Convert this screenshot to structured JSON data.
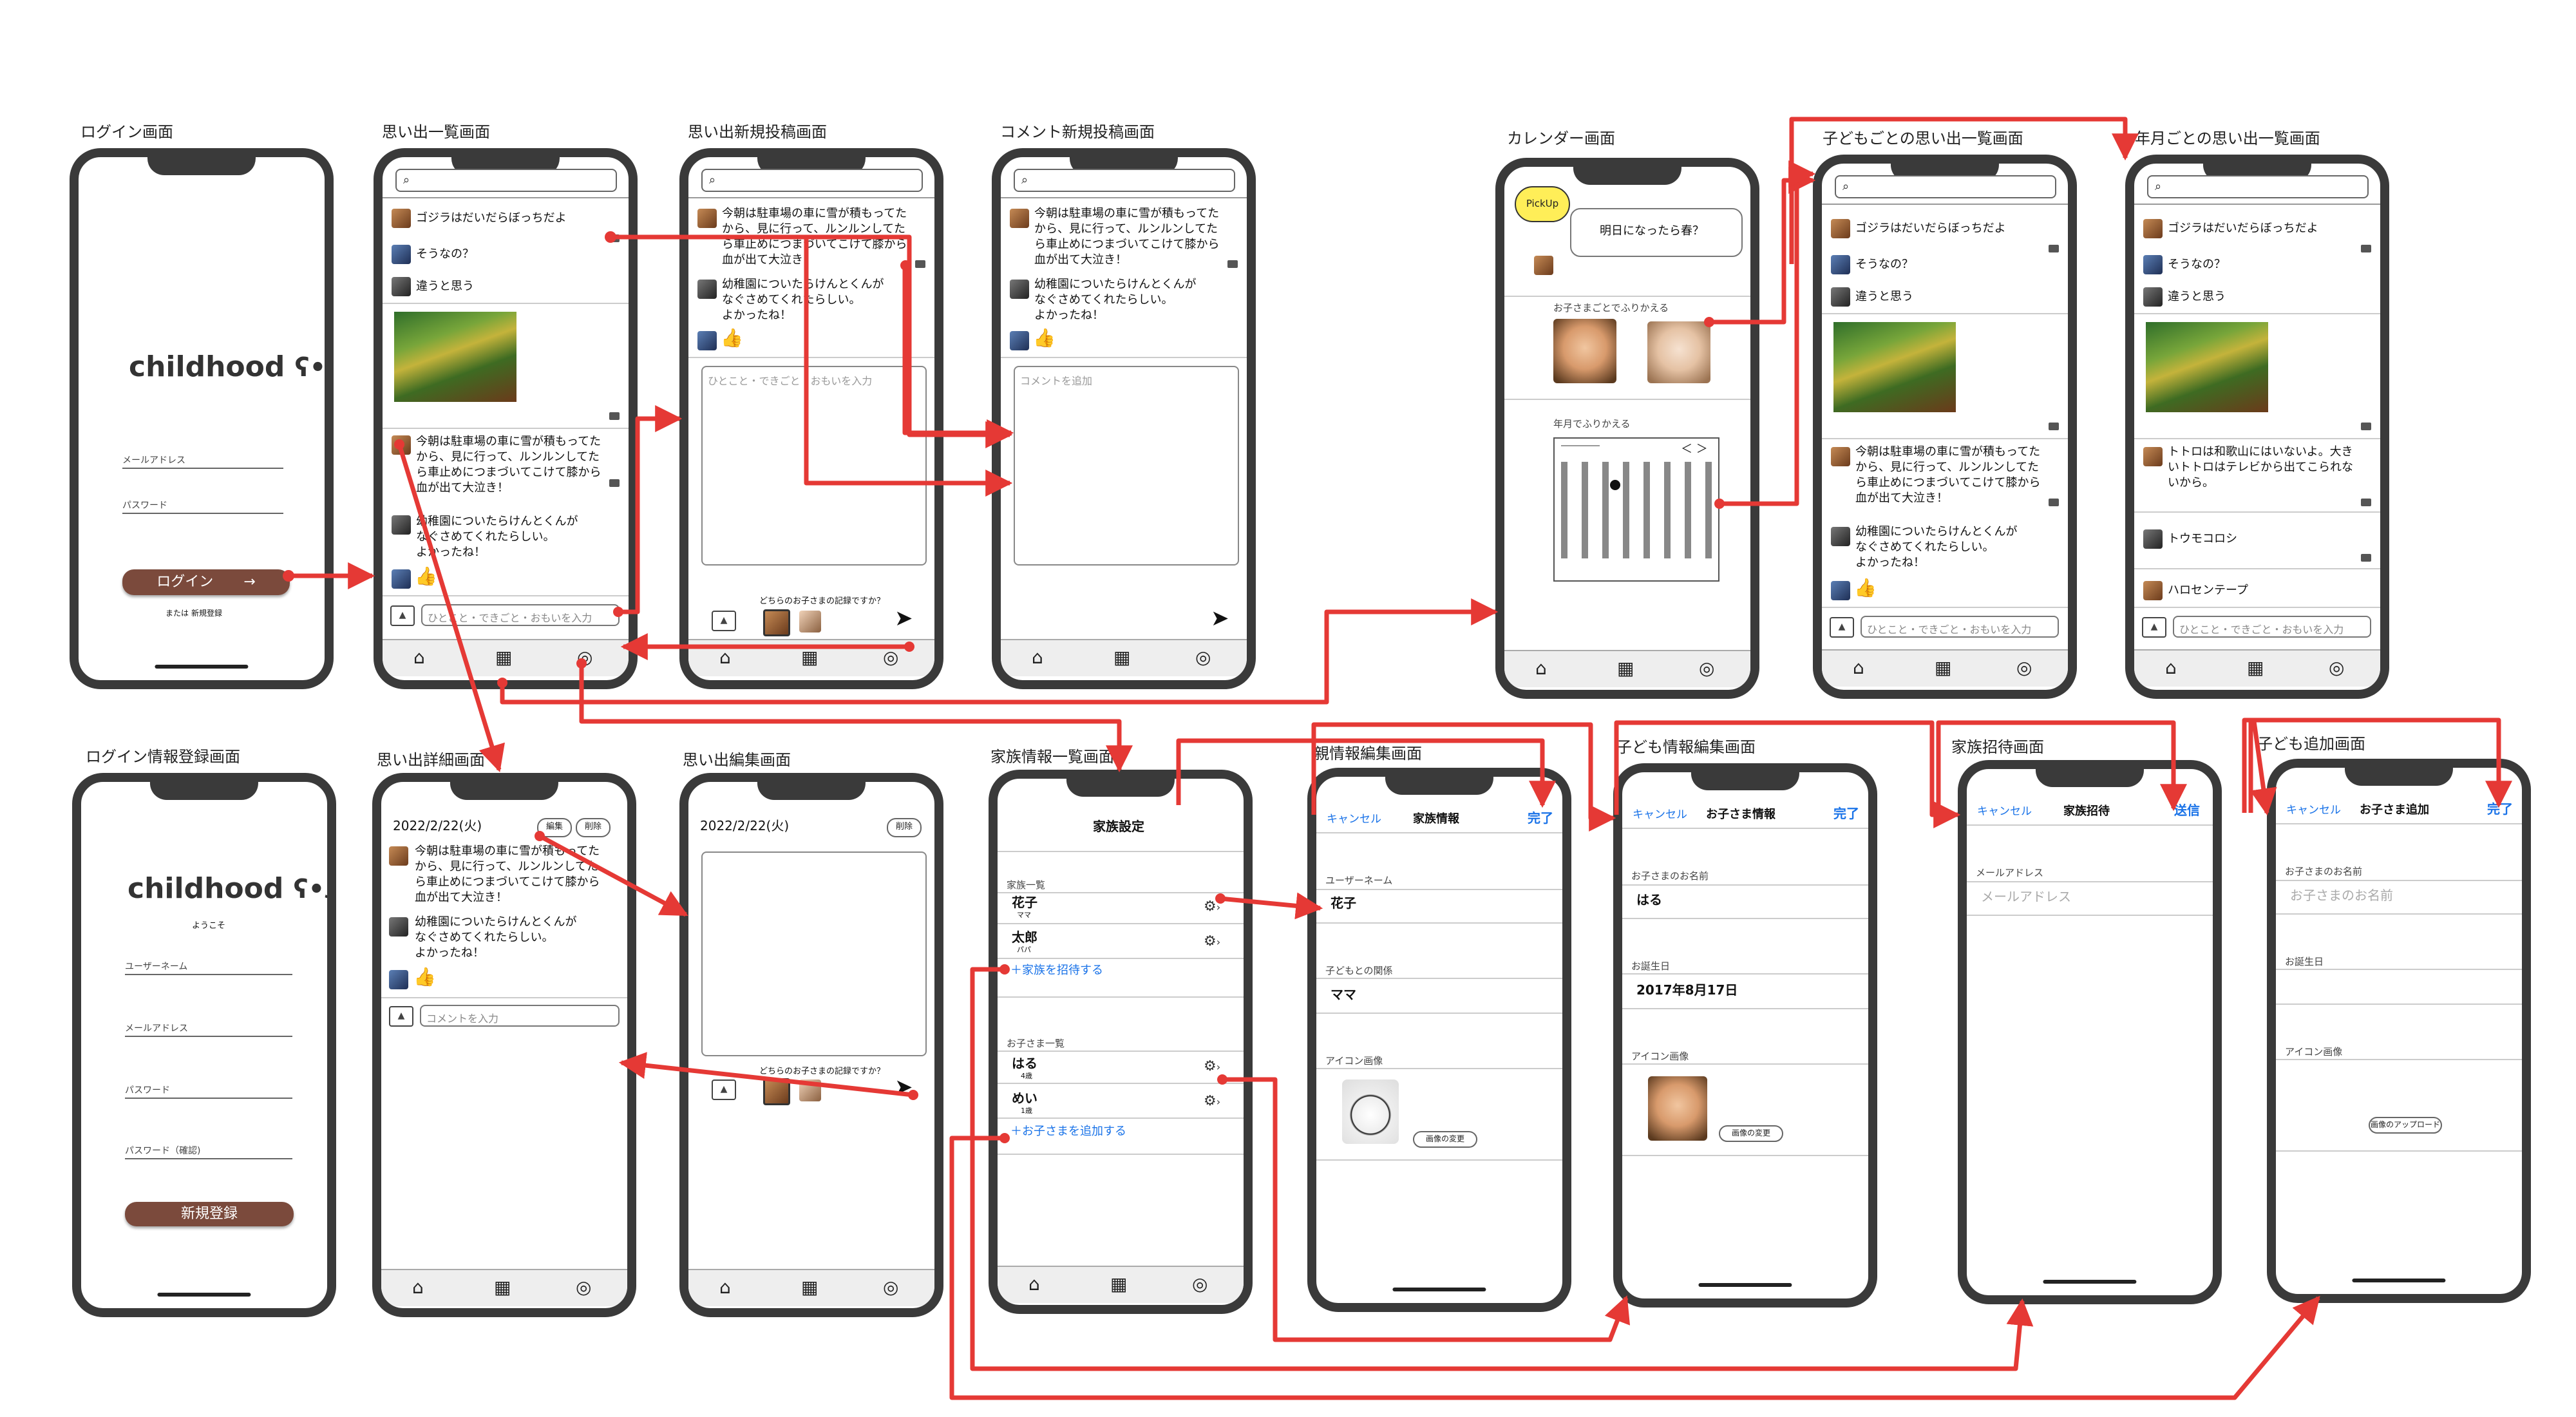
{
  "titles": {
    "login": "ログイン画面",
    "memories": "思い出一覧画面",
    "new_post": "思い出新規投稿画面",
    "new_comment": "コメント新規投稿画面",
    "calendar": "カレンダー画面",
    "child_memories": "子どもごとの思い出一覧画面",
    "yearly_memories": "年月ごとの思い出一覧画面",
    "register": "ログイン情報登録画面",
    "detail": "思い出詳細画面",
    "edit": "思い出編集画面",
    "family_list": "家族情報一覧画面",
    "parent_edit": "親情報編集画面",
    "child_edit": "子ども情報編集画面",
    "invite": "家族招待画面",
    "add_child": "子ども追加画面"
  },
  "app": {
    "logo": "childhood",
    "welcome": "ようこそ"
  },
  "login": {
    "email_label": "メールアドレス",
    "password_label": "パスワード",
    "login_button": "ログイン",
    "or": "または",
    "signup_link": "新規登録"
  },
  "register": {
    "username_label": "ユーザーネーム",
    "email_label": "メールアドレス",
    "password_label": "パスワード",
    "password_confirm_label": "パスワード（確認)",
    "signup_button": "新規登録"
  },
  "posts": {
    "p1": "ゴジラはだいだらぼっちだよ",
    "r1": "そうなの？",
    "r2": "違うと思う",
    "p2": [
      "今朝は駐車場の車に雪が積もってた",
      "から、見に行って、ルンルンしてた",
      "ら車止めにつまづいてこけて膝から",
      "血が出て大泣き！"
    ],
    "p3": [
      "幼稚園についたらけんとくんが",
      "なぐさめてくれたらしい。",
      "よかったね！"
    ],
    "p4": [
      "トトロは和歌山にはいないよ。大き",
      "いトトロはテレビから出てこられな",
      "いから。"
    ],
    "r3": "トウモコロシ",
    "r4": "ハロセンテープ"
  },
  "composer": {
    "post_placeholder": "ひとこと・できごと・おもいを入力",
    "comment_placeholder": "コメントを追加",
    "comment_input": "コメントを入力",
    "which_child": "どちらのお子さまの記録ですか？"
  },
  "calendar": {
    "pickup": "PickUp",
    "bubble": "明日になったら春？",
    "by_child": "お子さまごとでふりかえる",
    "by_month": "年月でふりかえる",
    "nav": "＜ ＞"
  },
  "detail": {
    "date": "2022/2/22(火)",
    "edit_button": "編集",
    "delete_button": "削除"
  },
  "family": {
    "header": "家族設定",
    "family_list": "家族一覧",
    "members": [
      {
        "name": "花子",
        "role": "ママ"
      },
      {
        "name": "太郎",
        "role": "パパ"
      }
    ],
    "invite_link": "＋家族を招待する",
    "children_list": "お子さま一覧",
    "children": [
      {
        "name": "はる",
        "age": "4歳"
      },
      {
        "name": "めい",
        "age": "1歳"
      }
    ],
    "add_child_link": "＋お子さまを追加する"
  },
  "parent_edit": {
    "cancel": "キャンセル",
    "title": "家族情報",
    "done": "完了",
    "username_label": "ユーザーネーム",
    "username": "花子",
    "relation_label": "子どもとの関係",
    "relation": "ママ",
    "icon_label": "アイコン画像",
    "change_image": "画像の変更"
  },
  "child_edit": {
    "cancel": "キャンセル",
    "title": "お子さま情報",
    "done": "完了",
    "name_label": "お子さまのお名前",
    "name": "はる",
    "birthday_label": "お誕生日",
    "birthday": "2017年8月17日",
    "icon_label": "アイコン画像",
    "change_image": "画像の変更"
  },
  "invite": {
    "cancel": "キャンセル",
    "title": "家族招待",
    "send": "送信",
    "email_label": "メールアドレス",
    "email_placeholder": "メールアドレス"
  },
  "add_child": {
    "cancel": "キャンセル",
    "title": "お子さま追加",
    "done": "完了",
    "name_label": "お子さまのお名前",
    "name_placeholder": "お子さまのお名前",
    "birthday_label": "お誕生日",
    "icon_label": "アイコン画像",
    "upload": "画像のアップロード"
  },
  "icons": {
    "home": "⌂",
    "calendar": "▦",
    "profile": "◎",
    "search": "⌕",
    "send": "➤",
    "like": "👍",
    "gear": "⚙",
    "arrow_right": "→",
    "chevron_right": "›"
  },
  "colors": {
    "arrow": "#e53935",
    "brand": "#7b4a3c",
    "link": "#1a73e8"
  }
}
